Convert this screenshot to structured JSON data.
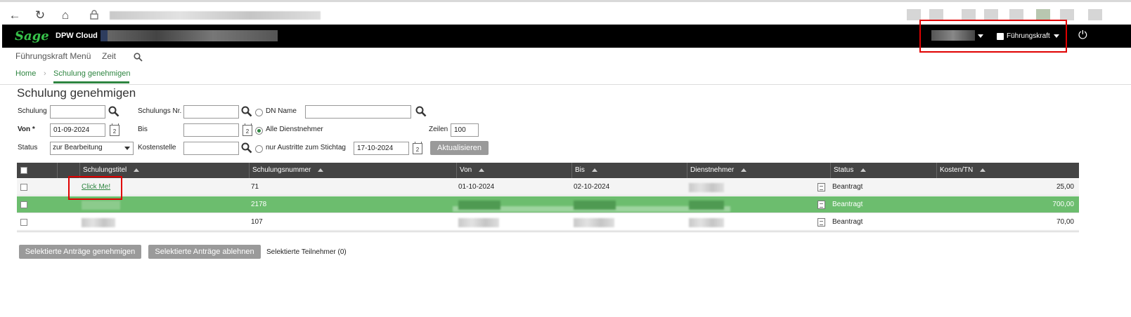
{
  "app": {
    "logo": "Sage",
    "name": "DPW Cloud",
    "role": "Führungskraft"
  },
  "menu": {
    "items": [
      "Führungskraft Menü",
      "Zeit"
    ]
  },
  "breadcrumb": {
    "home": "Home",
    "current": "Schulung genehmigen"
  },
  "page": {
    "title": "Schulung genehmigen"
  },
  "filters": {
    "schulung_label": "Schulung",
    "schulung_value": "",
    "schulungsnr_label": "Schulungs Nr.",
    "schulungsnr_value": "",
    "dn_name_label": "DN Name",
    "dn_name_value": "",
    "von_label": "Von *",
    "von_value": "01-09-2024",
    "bis_label": "Bis",
    "bis_value": "",
    "alle_label": "Alle Dienstnehmer",
    "zeilen_label": "Zeilen",
    "zeilen_value": "100",
    "status_label": "Status",
    "status_value": "zur Bearbeitung",
    "kostenstelle_label": "Kostenstelle",
    "kostenstelle_value": "",
    "austritte_label": "nur Austritte zum Stichtag",
    "stichtag_value": "17-10-2024",
    "cal_day": "2",
    "refresh_label": "Aktualisieren"
  },
  "table": {
    "headers": [
      "Schulungstitel",
      "Schulungsnummer",
      "Von",
      "Bis",
      "Dienstnehmer",
      "Status",
      "Kosten/TN"
    ],
    "rows": [
      {
        "title": "Click Me!",
        "nummer": "71",
        "von": "01-10-2024",
        "bis": "02-10-2024",
        "status": "Beantragt",
        "kosten": "25,00"
      },
      {
        "title": "",
        "nummer": "2178",
        "von": "",
        "bis": "",
        "status": "Beantragt",
        "kosten": "700,00"
      },
      {
        "title": "",
        "nummer": "107",
        "von": "",
        "bis": "",
        "status": "Beantragt",
        "kosten": "70,00"
      }
    ]
  },
  "actions": {
    "approve": "Selektierte Anträge genehmigen",
    "reject": "Selektierte Anträge ablehnen",
    "selected": "Selektierte Teilnehmer (0)"
  },
  "colors": {
    "accent": "#2e8540",
    "highlight_row": "#6cbd6e",
    "header_bg": "#000000",
    "table_header": "#444444",
    "annotation": "#e00000"
  }
}
